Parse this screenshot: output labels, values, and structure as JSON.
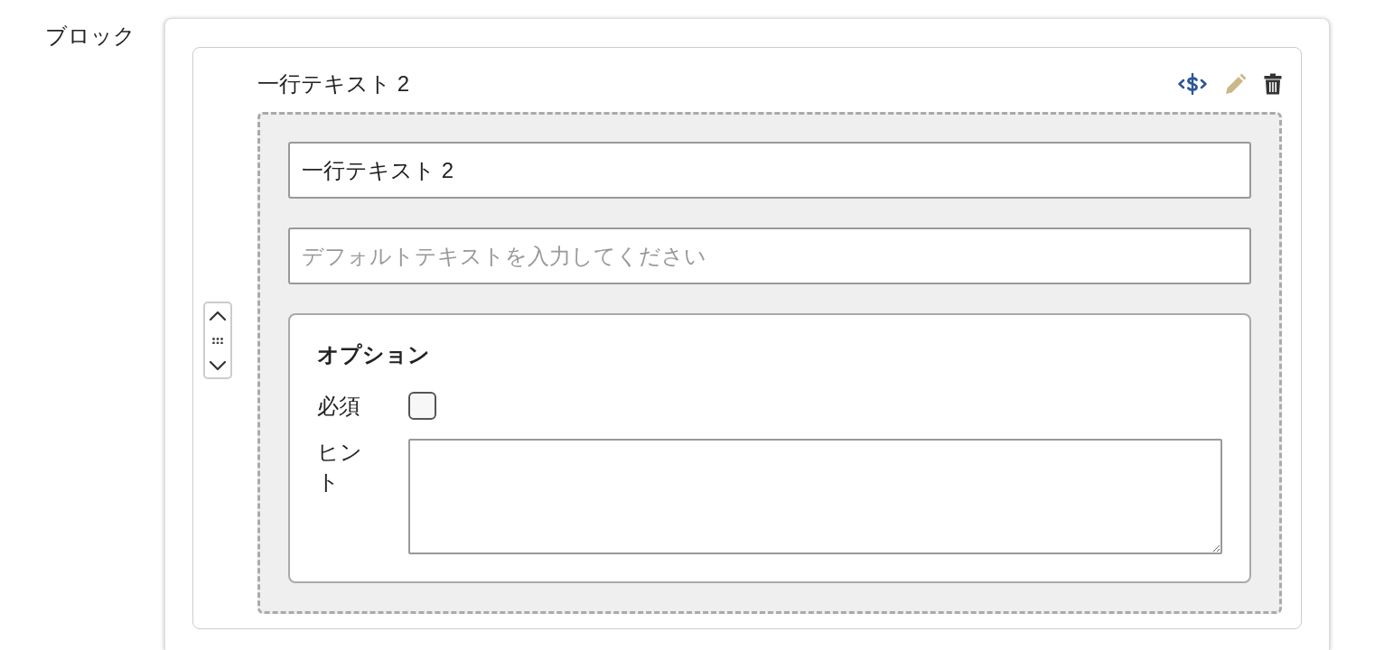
{
  "section_label": "ブロック",
  "block": {
    "title": "一行テキスト 2",
    "name_field": {
      "value": "一行テキスト 2"
    },
    "default_field": {
      "placeholder": "デフォルトテキストを入力してください"
    },
    "options": {
      "heading": "オプション",
      "fields": [
        {
          "kind": "checkbox",
          "label": "必須",
          "checked": false
        },
        {
          "kind": "textarea",
          "label": "ヒント"
        }
      ]
    }
  }
}
